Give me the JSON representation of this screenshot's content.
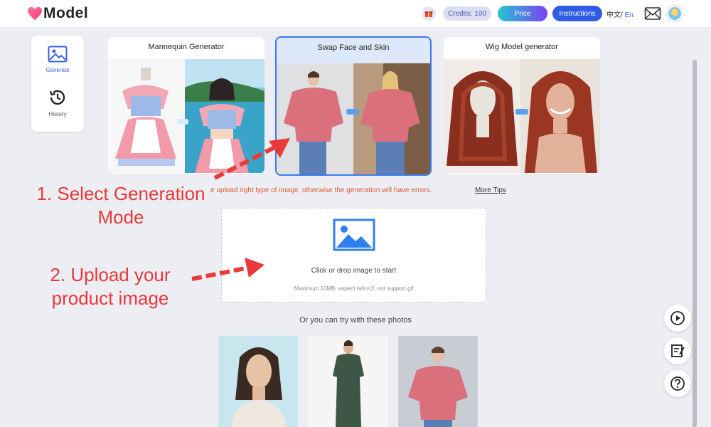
{
  "header": {
    "brand": "Model",
    "credits": "Credits: 100",
    "price_label": "Price",
    "instructions_label": "Instructions",
    "lang_zh": "中文",
    "lang_sep": "/ ",
    "lang_en": "En"
  },
  "sidebar": {
    "items": [
      {
        "label": "Generate",
        "icon": "image-icon"
      },
      {
        "label": "History",
        "icon": "history-icon"
      }
    ]
  },
  "modes": [
    {
      "title": "Mannequin Generator"
    },
    {
      "title": "Swap Face and Skin",
      "selected": true
    },
    {
      "title": "Wig Model generator"
    }
  ],
  "main": {
    "notice": "e upload right type of image, otherwise the generation will have errors.",
    "more_tips": "More Tips",
    "upload_text": "Click or drop image to start",
    "upload_hint": "Maximum 10MB, aspect ratio<2, not support gif",
    "try_text": "Or you can try with these photos"
  },
  "annotations": {
    "step1_line1": "1. Select Generation",
    "step1_line2": "Mode",
    "step2_line1": "2. Upload your",
    "step2_line2": "product image"
  },
  "colors": {
    "accent": "#3a63e0",
    "annotation": "#e8393b",
    "warning": "#e4572e"
  }
}
